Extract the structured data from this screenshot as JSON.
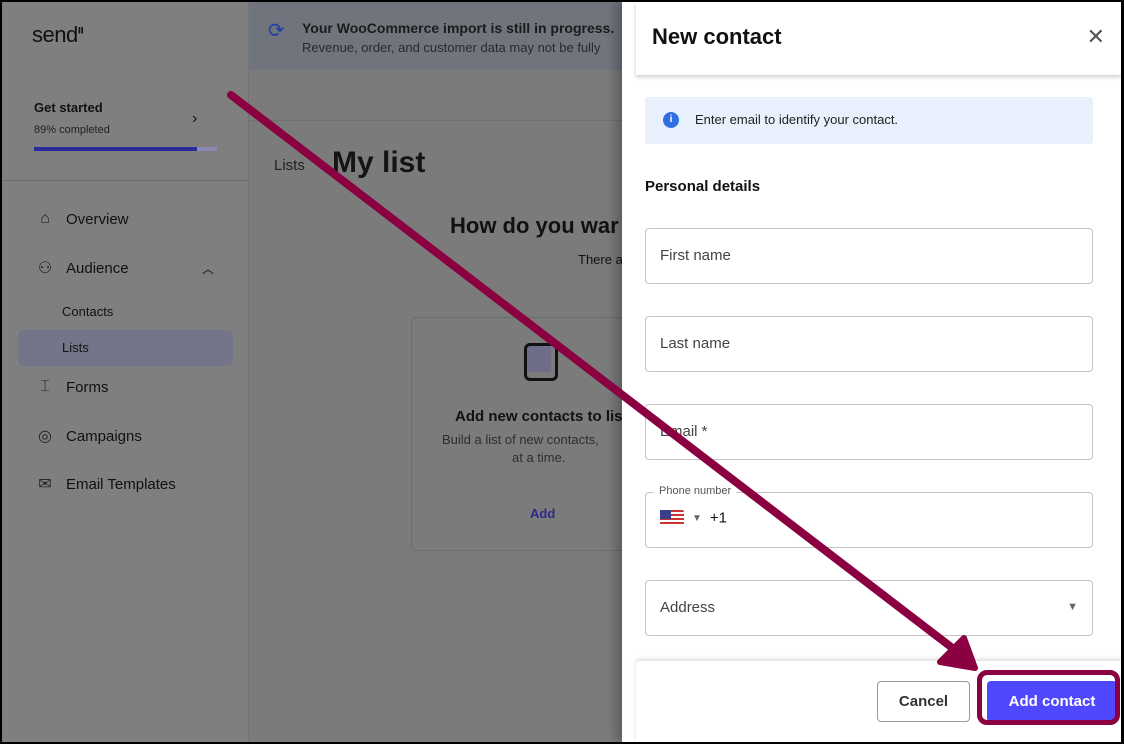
{
  "sidebar": {
    "logo": "send",
    "get_started": {
      "title": "Get started",
      "progress_label": "89% completed",
      "progress": 0.89
    },
    "items": [
      {
        "label": "Overview",
        "icon": "home-icon"
      },
      {
        "label": "Audience",
        "icon": "users-icon"
      },
      {
        "label": "Forms",
        "icon": "form-icon"
      },
      {
        "label": "Campaigns",
        "icon": "target-icon"
      },
      {
        "label": "Email Templates",
        "icon": "mail-icon"
      }
    ],
    "audience_sub": [
      {
        "label": "Contacts"
      },
      {
        "label": "Lists",
        "active": true
      }
    ]
  },
  "banner": {
    "line1": "Your WooCommerce import is still in progress.",
    "line2": "Revenue, order, and customer data may not be fully"
  },
  "main": {
    "breadcrumb": "Lists",
    "title": "My list",
    "question": "How do you war",
    "subtext": "There a",
    "card": {
      "title": "Add new contacts to lis",
      "desc1": "Build a list of new contacts,",
      "desc2": "at a time.",
      "action": "Add"
    }
  },
  "panel": {
    "title": "New contact",
    "info": "Enter email to identify your contact.",
    "section": "Personal details",
    "fields": {
      "first_name": "First name",
      "last_name": "Last name",
      "email": "Email *",
      "phone_label": "Phone number",
      "phone_code": "+1",
      "address": "Address"
    },
    "cancel": "Cancel",
    "add": "Add contact"
  },
  "colors": {
    "accent": "#5048ff",
    "annotation": "#8a0040"
  }
}
